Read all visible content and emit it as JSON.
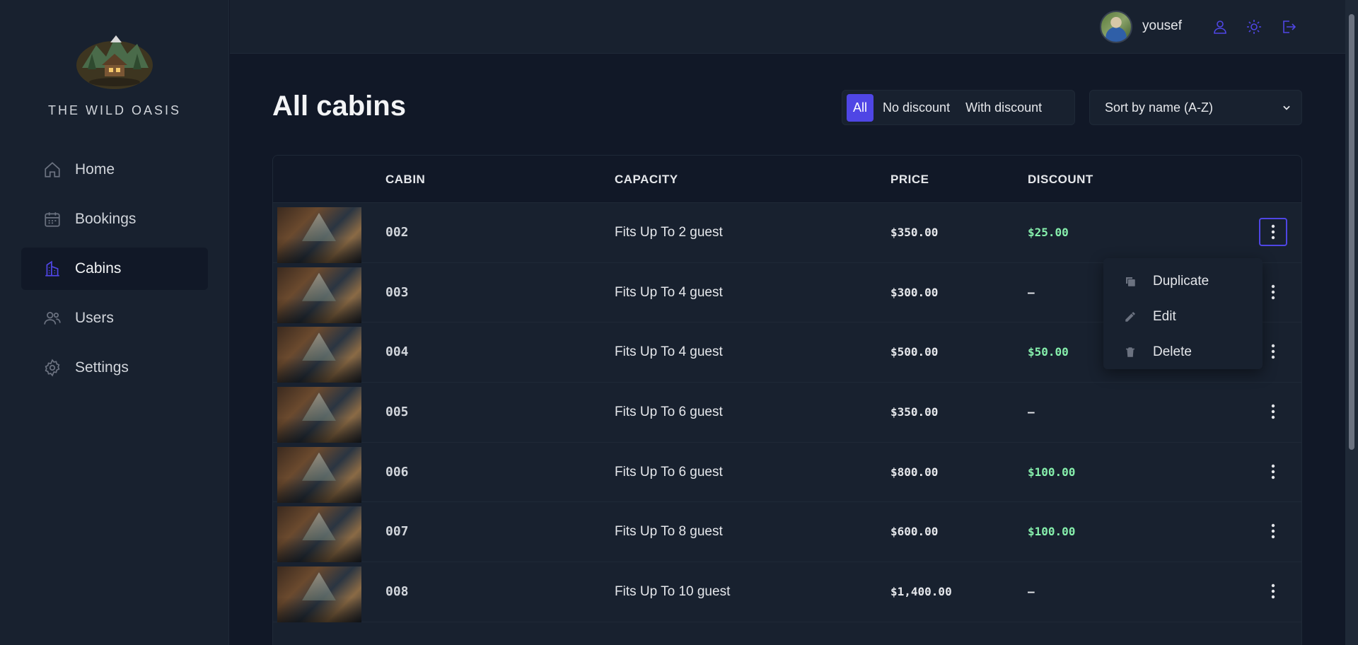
{
  "brand": {
    "name": "THE WILD OASIS"
  },
  "sidebar": {
    "items": [
      {
        "label": "Home",
        "icon": "home-icon"
      },
      {
        "label": "Bookings",
        "icon": "calendar-icon"
      },
      {
        "label": "Cabins",
        "icon": "building-icon",
        "active": true
      },
      {
        "label": "Users",
        "icon": "users-icon"
      },
      {
        "label": "Settings",
        "icon": "gear-icon"
      }
    ]
  },
  "header": {
    "username": "yousef",
    "actions": [
      "user-icon",
      "sun-icon",
      "logout-icon"
    ]
  },
  "main": {
    "title": "All cabins",
    "filter": {
      "options": [
        "All",
        "No discount",
        "With discount"
      ],
      "active": "All"
    },
    "sort": {
      "selected": "Sort by name (A-Z)"
    },
    "table": {
      "columns": [
        "",
        "CABIN",
        "CAPACITY",
        "PRICE",
        "DISCOUNT",
        ""
      ],
      "rows": [
        {
          "name": "002",
          "capacity": "Fits Up To 2 guest",
          "price": "$350.00",
          "discount": "$25.00"
        },
        {
          "name": "003",
          "capacity": "Fits Up To 4 guest",
          "price": "$300.00",
          "discount": "—"
        },
        {
          "name": "004",
          "capacity": "Fits Up To 4 guest",
          "price": "$500.00",
          "discount": "$50.00"
        },
        {
          "name": "005",
          "capacity": "Fits Up To 6 guest",
          "price": "$350.00",
          "discount": "—"
        },
        {
          "name": "006",
          "capacity": "Fits Up To 6 guest",
          "price": "$800.00",
          "discount": "$100.00"
        },
        {
          "name": "007",
          "capacity": "Fits Up To 8 guest",
          "price": "$600.00",
          "discount": "$100.00"
        },
        {
          "name": "008",
          "capacity": "Fits Up To 10 guest",
          "price": "$1,400.00",
          "discount": "—"
        }
      ]
    },
    "row_menu": {
      "items": [
        "Duplicate",
        "Edit",
        "Delete"
      ]
    }
  },
  "colors": {
    "accent": "#4f46e5",
    "discount": "#86efac",
    "background": "#111827",
    "surface": "#18212f"
  }
}
